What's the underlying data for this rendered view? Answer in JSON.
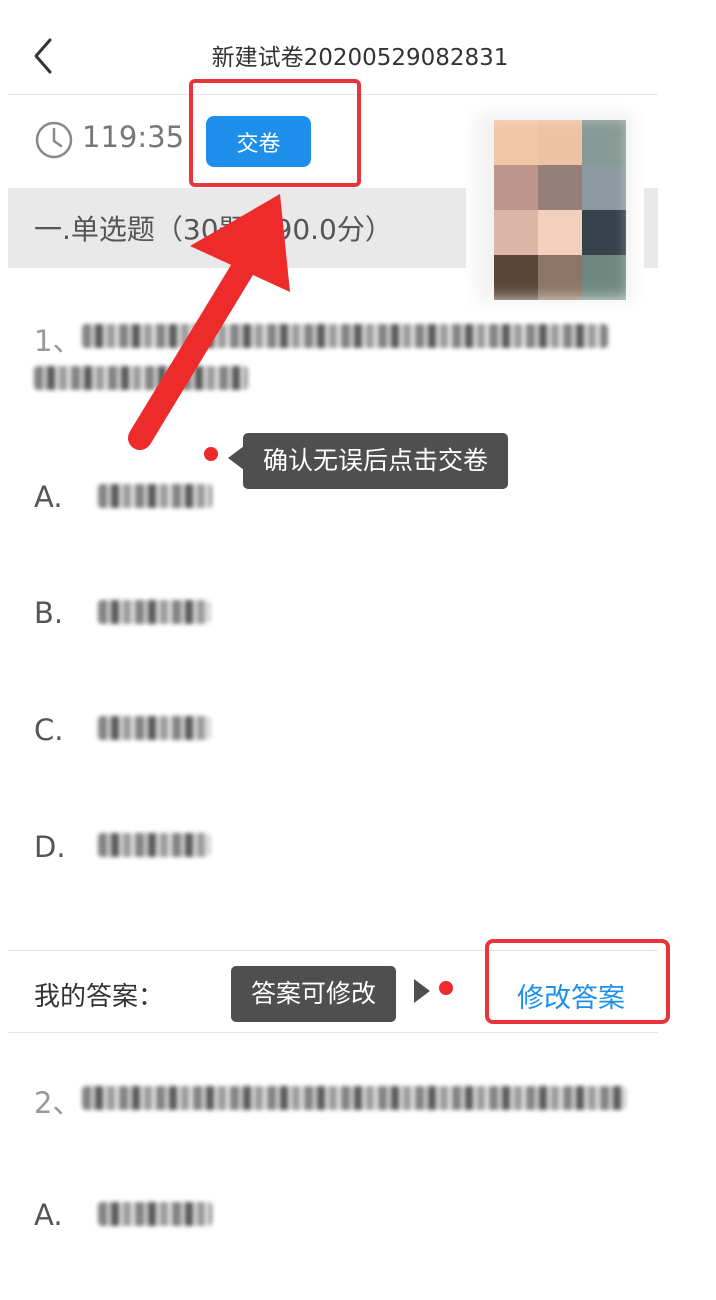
{
  "header": {
    "title": "新建试卷20200529082831",
    "back_icon": "chevron-left-icon"
  },
  "timer": {
    "icon": "clock-icon",
    "value": "119:35"
  },
  "submit": {
    "label": "交卷"
  },
  "section": {
    "title": "一.单选题（30题，90.0分）"
  },
  "camera": {
    "icon": "webcam-preview"
  },
  "question1": {
    "number": "1、",
    "options": [
      {
        "letter": "A."
      },
      {
        "letter": "B."
      },
      {
        "letter": "C."
      },
      {
        "letter": "D."
      }
    ]
  },
  "tooltips": {
    "submit_hint": "确认无误后点击交卷",
    "edit_hint": "答案可修改"
  },
  "answer": {
    "label": "我的答案：",
    "edit_label": "修改答案"
  },
  "question2": {
    "number": "2、",
    "options": [
      {
        "letter": "A."
      }
    ]
  },
  "colors": {
    "accent": "#1e90ec",
    "highlight": "#e8353b",
    "tooltip_bg": "#4f4f4f"
  }
}
